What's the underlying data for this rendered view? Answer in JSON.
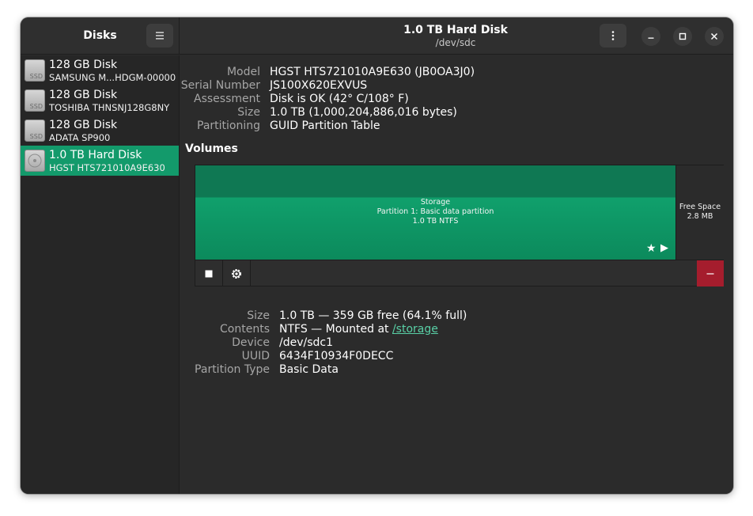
{
  "window": {
    "sidebar_title": "Disks",
    "title": "1.0 TB Hard Disk",
    "subtitle": "/dev/sdc"
  },
  "disks": [
    {
      "name": "128 GB Disk",
      "model": "SAMSUNG M...HDGM-00000",
      "icon": "ssd-icon",
      "icon_label": "SSD",
      "selected": false
    },
    {
      "name": "128 GB Disk",
      "model": "TOSHIBA THNSNJ128G8NY",
      "icon": "ssd-icon",
      "icon_label": "SSD",
      "selected": false
    },
    {
      "name": "128 GB Disk",
      "model": "ADATA SP900",
      "icon": "ssd-icon",
      "icon_label": "SSD",
      "selected": false
    },
    {
      "name": "1.0 TB Hard Disk",
      "model": "HGST HTS721010A9E630",
      "icon": "hard-disk-icon",
      "selected": true
    }
  ],
  "drive": {
    "model_label": "Model",
    "model": "HGST HTS721010A9E630 (JB0OA3J0)",
    "serial_label": "Serial Number",
    "serial": "JS100X620EXVUS",
    "assessment_label": "Assessment",
    "assessment": "Disk is OK (42° C/108° F)",
    "size_label": "Size",
    "size": "1.0 TB (1,000,204,886,016 bytes)",
    "partitioning_label": "Partitioning",
    "partitioning": "GUID Partition Table"
  },
  "volumes": {
    "title": "Volumes",
    "partition": {
      "line1": "Storage",
      "line2": "Partition 1: Basic data partition",
      "line3": "1.0 TB NTFS"
    },
    "free_space": {
      "line1": "Free Space",
      "line2": "2.8 MB"
    }
  },
  "volume_details": {
    "size_label": "Size",
    "size": "1.0 TB — 359 GB free (64.1% full)",
    "contents_label": "Contents",
    "contents_prefix": "NTFS — Mounted at ",
    "mount_point": "/storage",
    "device_label": "Device",
    "device": "/dev/sdc1",
    "uuid_label": "UUID",
    "uuid": "6434F10934F0DECC",
    "type_label": "Partition Type",
    "type": "Basic Data"
  },
  "colors": {
    "accent": "#139a6b",
    "partition_fill": "#10a06c",
    "delete_button": "#a51d2d",
    "link": "#59d0a6"
  }
}
